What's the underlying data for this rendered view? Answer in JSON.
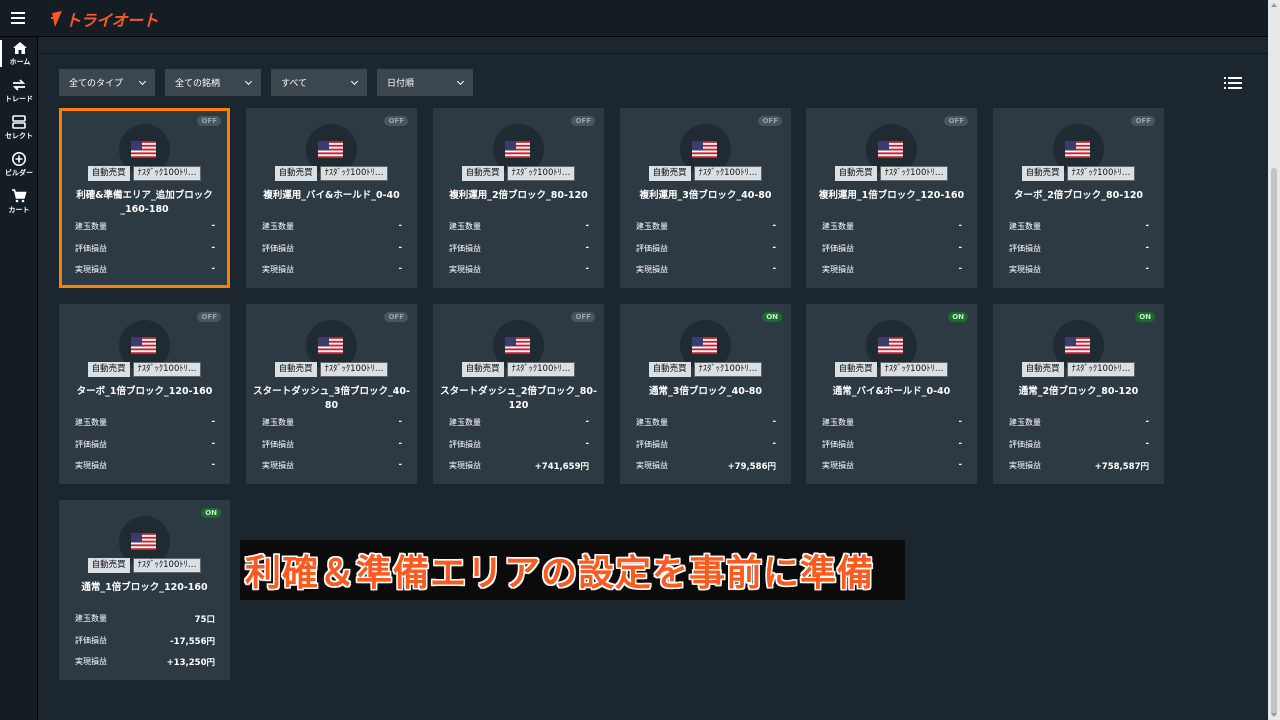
{
  "header": {
    "logo_text": "トライオート",
    "brand_color": "#ff5722",
    "menu_icon": "hamburger-icon"
  },
  "sidebar": {
    "items": [
      {
        "label": "ホーム",
        "icon": "home-icon",
        "active": true
      },
      {
        "label": "トレード",
        "icon": "trade-icon"
      },
      {
        "label": "セレクト",
        "icon": "select-icon"
      },
      {
        "label": "ビルダー",
        "icon": "add-circle-icon"
      },
      {
        "label": "カート",
        "icon": "cart-icon"
      }
    ]
  },
  "filters": [
    {
      "label": "全てのタイプ"
    },
    {
      "label": "全ての銘柄"
    },
    {
      "label": "すべて"
    },
    {
      "label": "日付順"
    }
  ],
  "view_toggle_icon": "list-view-icon",
  "card_labels": {
    "type_tag": "自動売買",
    "instrument_tag": "ﾅｽﾀﾞｯｸ100ﾄﾘ…",
    "row1": "建玉数量",
    "row2": "評価損益",
    "row3": "実現損益"
  },
  "cards": [
    {
      "status": "OFF",
      "name": "利確&準備エリア_追加ブロック_160-180",
      "qty": "-",
      "unrealized": "-",
      "realized": "-",
      "selected": true
    },
    {
      "status": "OFF",
      "name": "複利運用_バイ&ホールド_0-40",
      "qty": "-",
      "unrealized": "-",
      "realized": "-"
    },
    {
      "status": "OFF",
      "name": "複利運用_2倍ブロック_80-120",
      "qty": "-",
      "unrealized": "-",
      "realized": "-"
    },
    {
      "status": "OFF",
      "name": "複利運用_3倍ブロック_40-80",
      "qty": "-",
      "unrealized": "-",
      "realized": "-"
    },
    {
      "status": "OFF",
      "name": "複利運用_1倍ブロック_120-160",
      "qty": "-",
      "unrealized": "-",
      "realized": "-"
    },
    {
      "status": "OFF",
      "name": "ターボ_2倍ブロック_80-120",
      "qty": "-",
      "unrealized": "-",
      "realized": "-"
    },
    {
      "status": "OFF",
      "name": "ターボ_1倍ブロック_120-160",
      "qty": "-",
      "unrealized": "-",
      "realized": "-"
    },
    {
      "status": "OFF",
      "name": "スタートダッシュ_3倍ブロック_40-80",
      "qty": "-",
      "unrealized": "-",
      "realized": "-"
    },
    {
      "status": "OFF",
      "name": "スタートダッシュ_2倍ブロック_80-120",
      "qty": "-",
      "unrealized": "-",
      "realized": "+741,659円"
    },
    {
      "status": "ON",
      "name": "通常_3倍ブロック_40-80",
      "qty": "-",
      "unrealized": "-",
      "realized": "+79,586円"
    },
    {
      "status": "ON",
      "name": "通常_バイ&ホールド_0-40",
      "qty": "-",
      "unrealized": "-",
      "realized": "-"
    },
    {
      "status": "ON",
      "name": "通常_2倍ブロック_80-120",
      "qty": "-",
      "unrealized": "-",
      "realized": "+758,587円"
    },
    {
      "status": "ON",
      "name": "通常_1倍ブロック_120-160",
      "qty": "75口",
      "unrealized": "-17,556円",
      "realized": "+13,250円"
    }
  ],
  "caption": "利確＆準備エリアの設定を事前に準備",
  "colors": {
    "selected_border": "#ff7f00",
    "on_badge": "#1e6b2e",
    "off_badge": "#4a555d",
    "caption_text": "#ff5a1f"
  }
}
